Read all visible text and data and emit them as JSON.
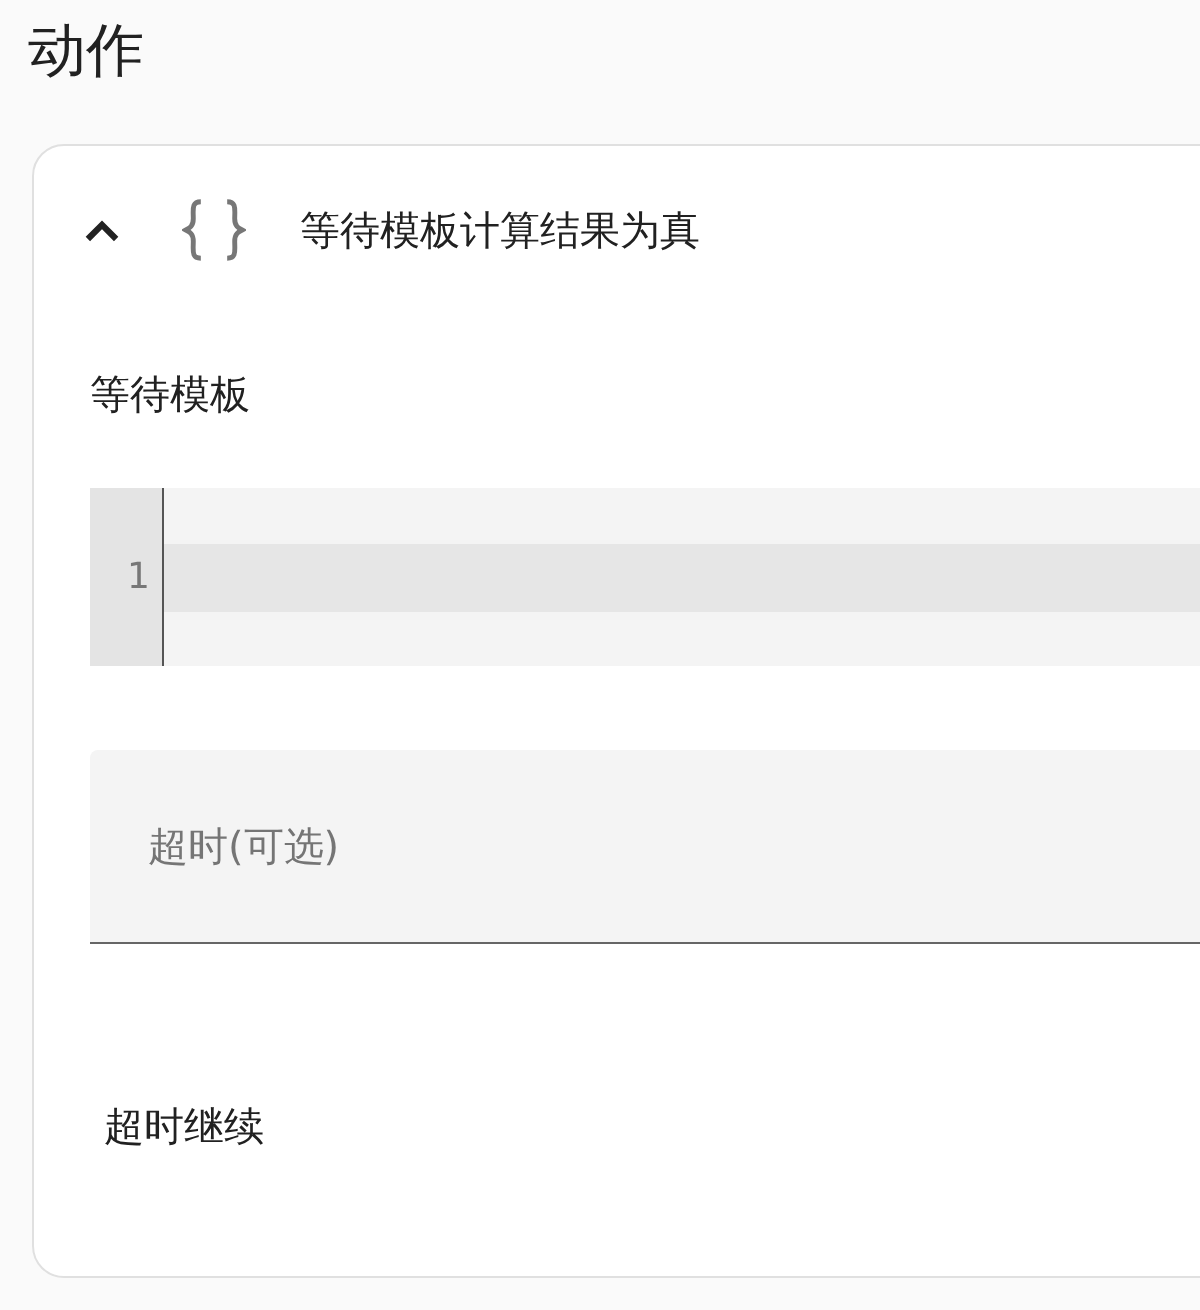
{
  "title": "动作",
  "action": {
    "expanded": true,
    "title": "等待模板计算结果为真",
    "fields": [
      {
        "kind": "code",
        "label": "等待模板",
        "line_numbers": [
          "1"
        ]
      },
      {
        "kind": "text",
        "placeholder": "超时(可选)"
      },
      {
        "kind": "label",
        "label": "超时继续"
      }
    ]
  }
}
